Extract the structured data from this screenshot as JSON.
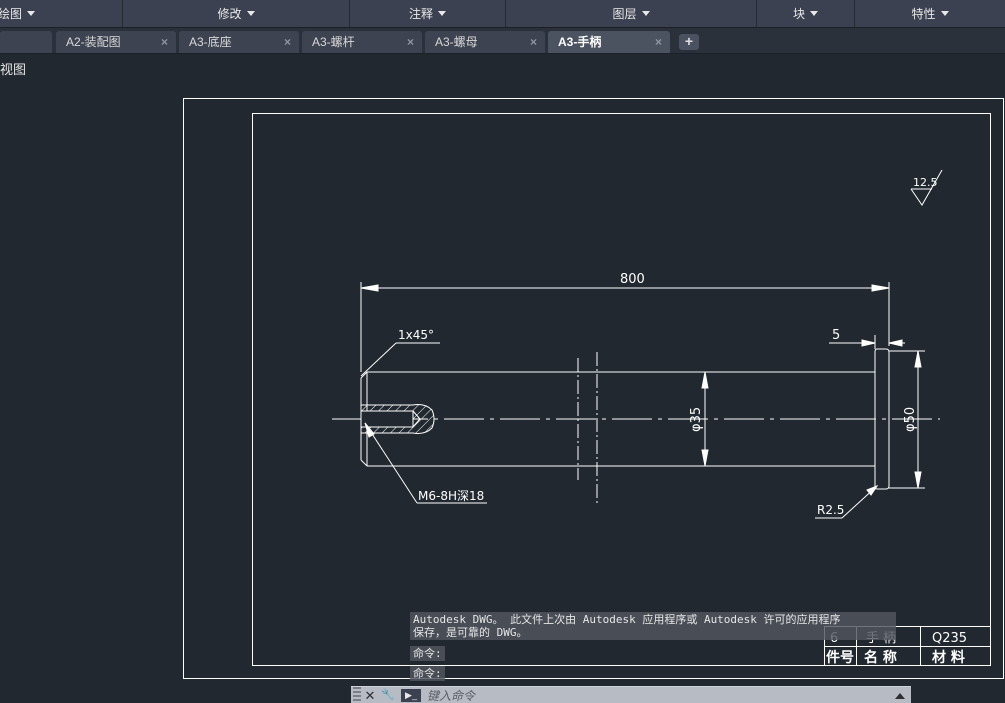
{
  "ribbon": {
    "panels": [
      {
        "label": "绘图"
      },
      {
        "label": "修改"
      },
      {
        "label": "注释"
      },
      {
        "label": "图层"
      },
      {
        "label": "块"
      },
      {
        "label": "特性"
      }
    ]
  },
  "tabs": [
    {
      "label": "A2-装配图",
      "active": false
    },
    {
      "label": "A3-底座",
      "active": false
    },
    {
      "label": "A3-螺杆",
      "active": false
    },
    {
      "label": "A3-螺母",
      "active": false
    },
    {
      "label": "A3-手柄",
      "active": true
    }
  ],
  "tab_add_label": "+",
  "tab_close_label": "×",
  "view_label": "俯视图",
  "drawing": {
    "dim_length": "800",
    "dim_chamfer": "1x45°",
    "dim_shoulder": "5",
    "dim_shaft_dia": "φ35",
    "dim_head_dia": "φ50",
    "dim_thread": "M6-8H深18",
    "dim_radius": "R2.5",
    "surface_roughness": "12.5"
  },
  "title_block": {
    "part_no": "6",
    "part_name": "手 柄",
    "material": "Q235",
    "hdr_part_no": "件号",
    "hdr_name": "名 称",
    "hdr_material": "材 料"
  },
  "command": {
    "message_line1": "Autodesk DWG。  此文件上次由 Autodesk 应用程序或 Autodesk 许可的应用程序",
    "message_line2": "保存，是可靠的 DWG。",
    "prompt1": "命令:",
    "prompt2": "命令:",
    "input_placeholder": "键入命令",
    "close_icon_glyph": "✕",
    "settings_icon_glyph": "🔧",
    "prompt_icon_glyph": "▶_"
  },
  "colors": {
    "background": "#212830",
    "ribbon": "#3b4150",
    "lines": "#ffffff"
  }
}
